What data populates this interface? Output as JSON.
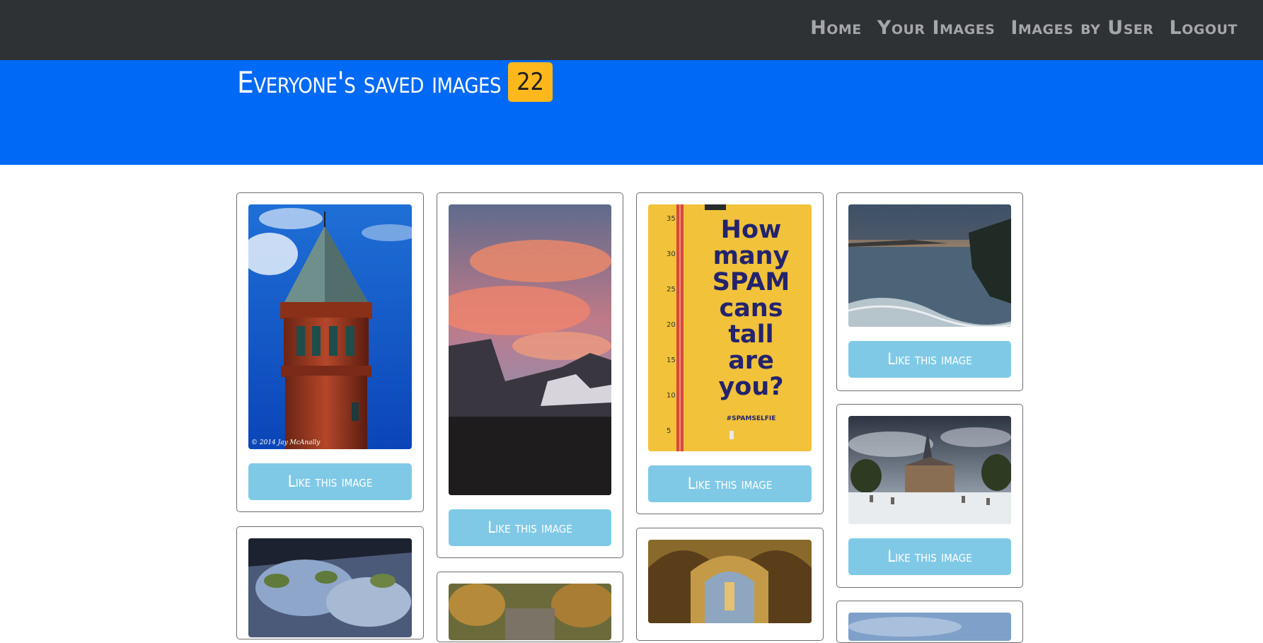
{
  "nav": {
    "home": "Home",
    "your_images": "Your Images",
    "images_by_user": "Images by User",
    "logout": "Logout"
  },
  "hero": {
    "title": "Everyone's saved images",
    "count": "22"
  },
  "cards": {
    "like_label": "Like this image"
  },
  "spam_sign": {
    "lines": [
      "How",
      "many",
      "SPAM",
      "cans",
      "tall",
      "are",
      "you?"
    ],
    "tag": "#SPAMSELFIE",
    "ruler": [
      "35",
      "30",
      "25",
      "20",
      "15",
      "10",
      "5"
    ]
  },
  "tower_photo": {
    "watermark": "© 2014 Jay McAnally"
  },
  "colors": {
    "navbar": "#2f3235",
    "hero": "#0069f5",
    "badge": "#ffb81c",
    "like_button": "#80c9e6"
  }
}
